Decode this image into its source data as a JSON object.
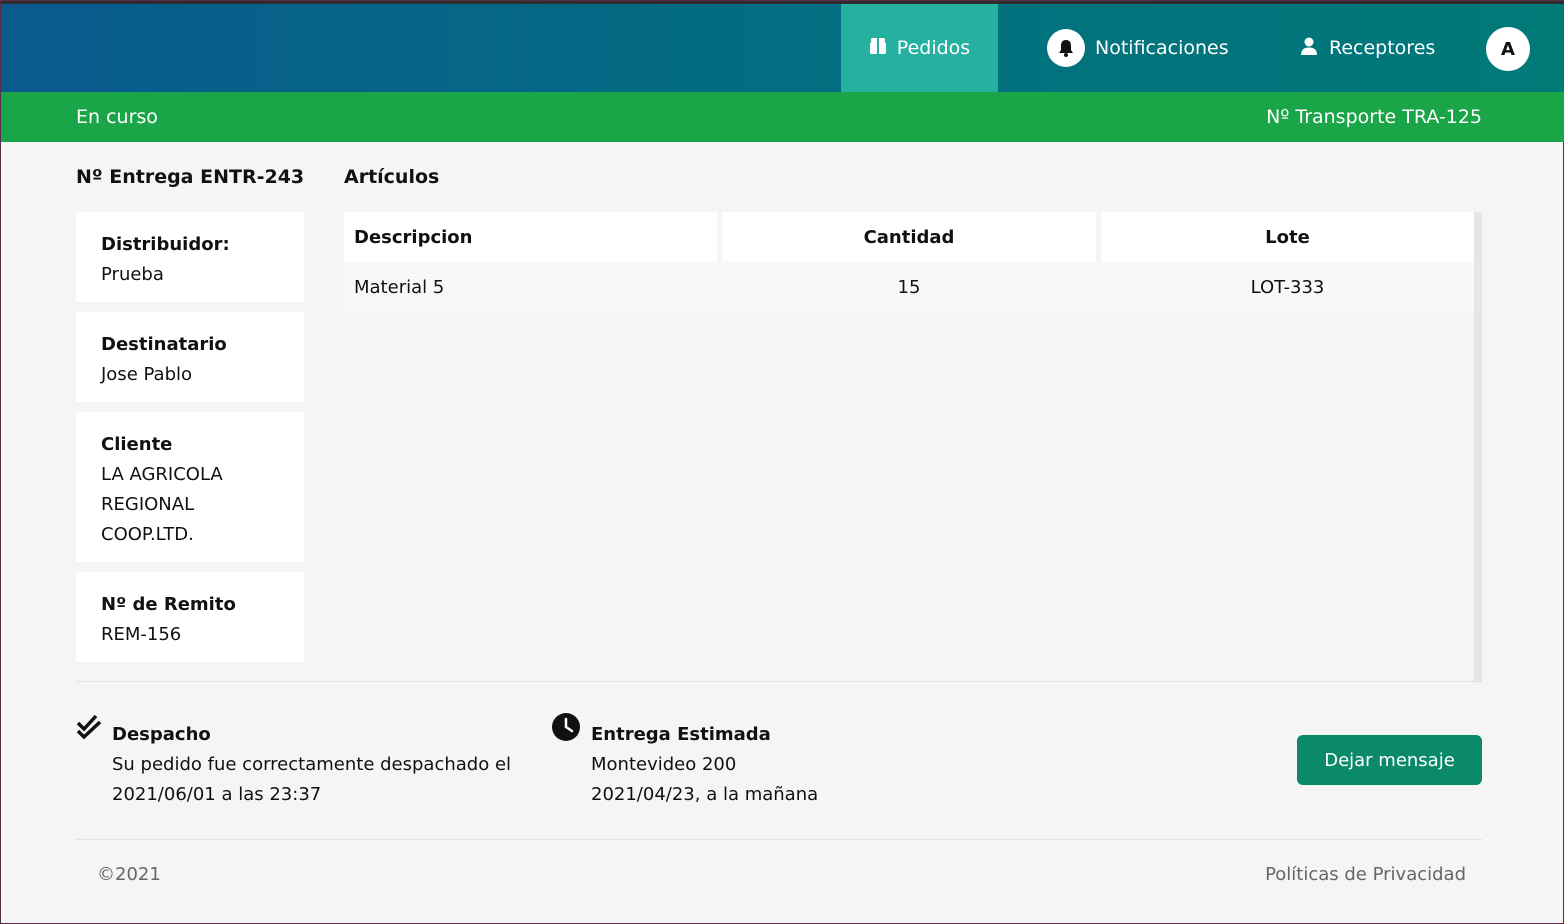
{
  "nav": {
    "pedidos": "Pedidos",
    "notificaciones": "Notificaciones",
    "receptores": "Receptores",
    "avatar_initial": "A"
  },
  "status": {
    "state": "En curso",
    "transport": "Nº Transporte TRA-125"
  },
  "entrega": {
    "title": "Nº Entrega ENTR-243",
    "cards": [
      {
        "label": "Distribuidor:",
        "value": "Prueba"
      },
      {
        "label": "Destinatario",
        "value": "Jose Pablo"
      },
      {
        "label": "Cliente",
        "value_lines": [
          "LA AGRICOLA",
          "REGIONAL",
          "COOP.LTD."
        ]
      },
      {
        "label": "Nº de Remito",
        "value": "REM-156"
      }
    ]
  },
  "articulos": {
    "title": "Artículos",
    "columns": [
      "Descripcion",
      "Cantidad",
      "Lote"
    ],
    "rows": [
      {
        "descripcion": "Material 5",
        "cantidad": "15",
        "lote": "LOT-333"
      }
    ]
  },
  "despacho": {
    "label": "Despacho",
    "line1": "Su pedido fue correctamente despachado el",
    "line2": "2021/06/01 a las 23:37"
  },
  "entrega_estimada": {
    "label": "Entrega Estimada",
    "line1": "Montevideo 200",
    "line2": "2021/04/23, a la mañana"
  },
  "actions": {
    "leave_message": "Dejar mensaje"
  },
  "footer": {
    "copyright": "©2021",
    "privacy": "Políticas de Privacidad"
  }
}
